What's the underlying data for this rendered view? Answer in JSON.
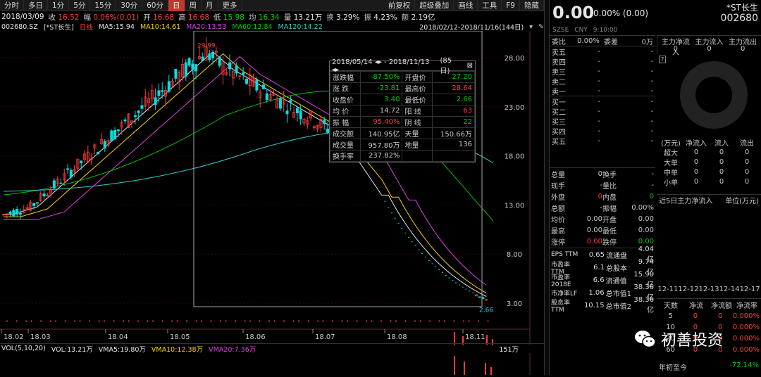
{
  "toolbar": {
    "tabs": [
      "分时",
      "多日",
      "1分",
      "5分",
      "15分",
      "30分",
      "60分",
      "日",
      "周",
      "月",
      "更多"
    ],
    "active_index": 7,
    "right_items": [
      "前复权",
      "超级叠加",
      "画线",
      "工具",
      "F9",
      "隐藏"
    ]
  },
  "info": {
    "date": "2018/03/09",
    "close_label": "收",
    "close": "16.52",
    "chg_label": "幅",
    "chg": "0.06%(0.01)",
    "open_label": "开",
    "open": "16.68",
    "high_label": "高",
    "high": "16.68",
    "low_label": "低",
    "low": "15.98",
    "avg_label": "均",
    "avg": "16.34",
    "vol_label": "量",
    "vol": "13.21万",
    "turn_label": "换",
    "turn": "3.29%",
    "amp_label": "振",
    "amp": "4.23%",
    "amt_label": "额",
    "amt": "2.19亿"
  },
  "ma": {
    "code": "002680.SZ",
    "name": "[*ST长生]",
    "period": "日线",
    "ma5": "MA5:15.94",
    "ma10": "MA10:14.61",
    "ma20": "MA20:13.53",
    "ma60": "MA60:13.84",
    "ma120": "MA120:14.22",
    "range": "2018/02/12-2018/11/16(144日)"
  },
  "chart_data": {
    "type": "candlestick",
    "y_ticks": [
      28.0,
      23.0,
      18.0,
      13.0,
      8.0,
      3.0
    ],
    "y_tick_labels": [
      "28.00",
      "23.00",
      "18.00",
      "13.00",
      "8.00",
      "3.00"
    ],
    "x_ticks": [
      "18.02",
      "18.03",
      "18.04",
      "18.05",
      "18.06",
      "18.07",
      "18.08",
      "18.11"
    ],
    "high_marker": "29.99",
    "low_marker": "2.66",
    "colors": {
      "up": "#ff3b3b",
      "down": "#00e0e0",
      "ma5": "#e6e6e6",
      "ma10": "#ffd400",
      "ma20": "#e040e0",
      "ma60": "#00c000",
      "ma120": "#33cccc"
    }
  },
  "tooltip": {
    "range": "2018/05/14 ◂▸ - 2018/11/13 ◂▸",
    "days": "(85日)",
    "rows": [
      [
        "涨跌幅",
        "-87.50%",
        "开盘价",
        "27.20"
      ],
      [
        "涨  跌",
        "-23.81",
        "最高价",
        "28.64"
      ],
      [
        "收盘价",
        "3.40",
        "最低价",
        "2.66"
      ],
      [
        "均  价",
        "14.72",
        "阳  线",
        "63"
      ],
      [
        "振  幅",
        "95.40%",
        "阴  线",
        "22"
      ],
      [
        "成交额",
        "140.95亿",
        "天量",
        "150.66万"
      ],
      [
        "成交量",
        "957.80万",
        "地量",
        "136"
      ],
      [
        "换手率",
        "237.82%",
        "",
        ""
      ]
    ]
  },
  "volume": {
    "label": "VOL(5,10,20)",
    "vol": "VOL:13.21万",
    "vma5": "VMA5:19.80万",
    "vma10": "VMA10:12.38万",
    "vma20": "VMA20:7.36万",
    "max_tick": "151万"
  },
  "quote": {
    "price": "0.00",
    "change": "0.00% (0.00)",
    "name": "*ST长生",
    "code": "002680",
    "exchange": "SZSE",
    "currency": "CNY",
    "time": "9:10:00"
  },
  "orderbook": {
    "header": [
      "委比",
      "0.00%",
      "委差",
      "0万"
    ],
    "asks": [
      "卖五",
      "卖四",
      "卖三",
      "卖二",
      "卖一"
    ],
    "bids": [
      "买一",
      "买二",
      "买三",
      "买四",
      "买五"
    ],
    "dash": "-"
  },
  "stats": [
    [
      "总量",
      "0",
      "换手",
      "-"
    ],
    [
      "现手",
      "-",
      "量比",
      "-"
    ],
    [
      "外盘",
      "0",
      "内盘",
      "0"
    ],
    [
      "总额",
      "-",
      "振幅",
      "0.00%"
    ],
    [
      "均价",
      "0.00",
      "开盘",
      "0.00"
    ],
    [
      "最高",
      "0.00",
      "最低",
      "0.00"
    ],
    [
      "涨停",
      "0.00",
      "跌停",
      "0.00"
    ]
  ],
  "fin": [
    [
      "EPS TTM",
      "0.65",
      "流通盘",
      "4.04亿"
    ],
    [
      "市盈率TTM",
      "6.1",
      "总股本",
      "9.74亿"
    ],
    [
      "市盈率2018E",
      "6.6",
      "流通值",
      "15.90亿"
    ],
    [
      "市净率LF",
      "1.06",
      "总市值1",
      "38.36亿"
    ],
    [
      "股息率TTM",
      "10.15",
      "总市值2",
      "38.36亿"
    ]
  ],
  "flow": {
    "headers": [
      "主力净流入",
      "主力流入",
      "主力流出"
    ],
    "values": [
      "0",
      "0",
      "0"
    ],
    "table_headers": [
      "(万元)",
      "净流入",
      "流入",
      "流出"
    ],
    "table_rows": [
      [
        "超大",
        "0",
        "0",
        "0"
      ],
      [
        "大单",
        "0",
        "0",
        "0"
      ],
      [
        "中单",
        "0",
        "0",
        "0"
      ],
      [
        "小单",
        "0",
        "0",
        "0"
      ]
    ],
    "five_day": "近5日主力净流入",
    "unit": "单位(万元)",
    "dates": "12-1112-1212-1312-1412-17",
    "day_headers": [
      "天数",
      "净流",
      "净流额",
      "净流率"
    ],
    "day_rows": [
      [
        "5",
        "0",
        "0",
        "0.000%"
      ],
      [
        "10",
        "0",
        "0",
        "0.000%"
      ],
      [
        "20",
        "0",
        "0",
        "0.000%"
      ],
      [
        "60",
        "0",
        "0",
        "0.000%"
      ]
    ],
    "ytd_label": "年初至今",
    "ytd": "-72.14%"
  },
  "watermark": "初善投资"
}
